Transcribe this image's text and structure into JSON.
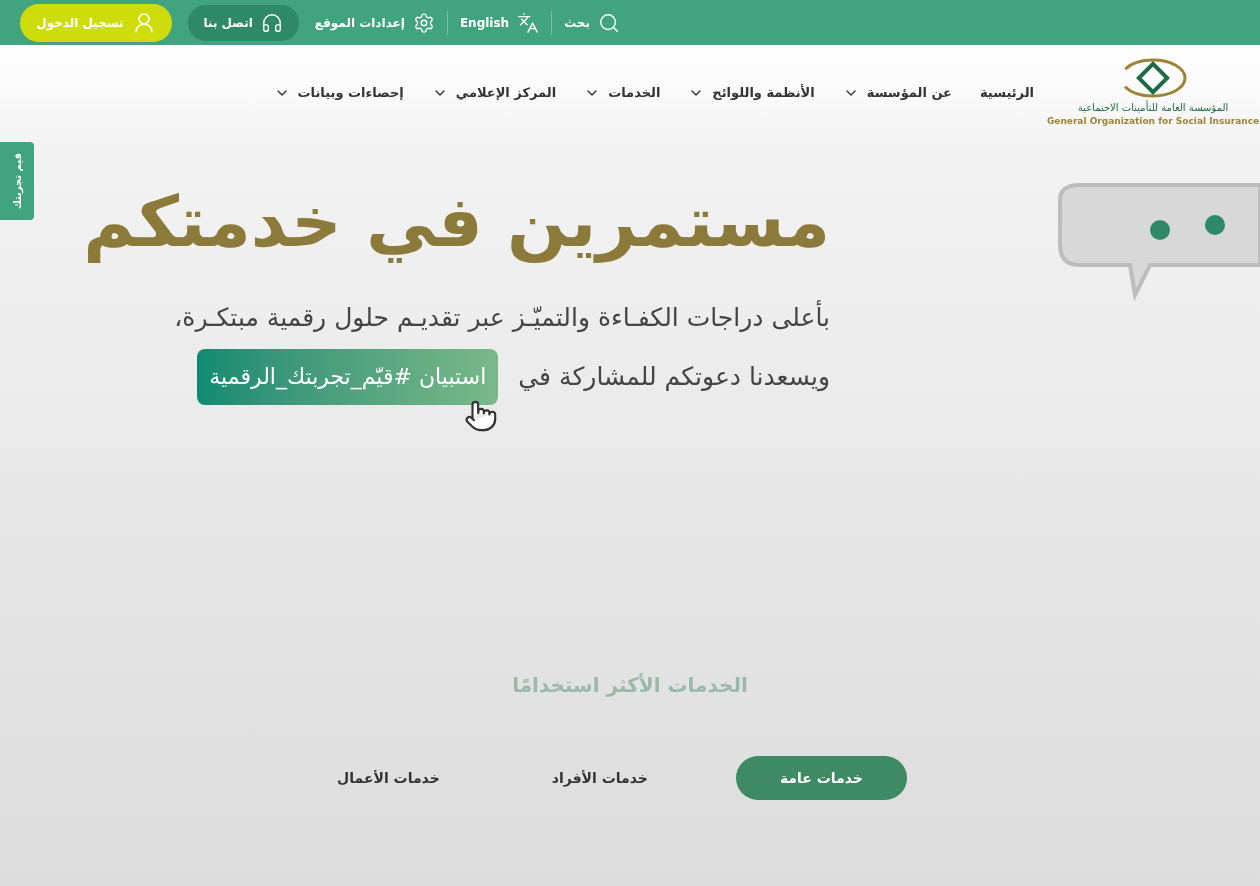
{
  "top_bar": {
    "search": "بحث",
    "language": "English",
    "settings": "إعدادات الموقع",
    "contact": "اتصل بنا",
    "login": "تسجيل الدخول"
  },
  "logo": {
    "arabic": "المؤسسة العامة للتأمينات الاجتماعية",
    "english": "General Organization for Social Insurance"
  },
  "nav": [
    {
      "label": "الرئيسية",
      "has_menu": false
    },
    {
      "label": "عن المؤسسة",
      "has_menu": true
    },
    {
      "label": "الأنظمة واللوائح",
      "has_menu": true
    },
    {
      "label": "الخدمات",
      "has_menu": true
    },
    {
      "label": "المركز الإعلامي",
      "has_menu": true
    },
    {
      "label": "إحصاءات وبيانات",
      "has_menu": true
    }
  ],
  "feedback_tab": "قيم تجربتك",
  "hero": {
    "title": "مستمرين في خدمتكم",
    "line_1": "بأعلى دراجات الكفـاءة والتميّـز عبر تقديـم حلول رقمية مبتكـرة،",
    "line_2": "ويسعدنا دعوتكم للمشاركة في",
    "survey_button": "استبيان #قيّم_تجربتك_الرقمية"
  },
  "services": {
    "title": "الخدمات الأكثر استخدامًا",
    "tabs": [
      {
        "label": "خدمات عامة",
        "selected": true
      },
      {
        "label": "خدمات الأفراد",
        "selected": false
      },
      {
        "label": "خدمات الأعمال",
        "selected": false
      }
    ]
  }
}
